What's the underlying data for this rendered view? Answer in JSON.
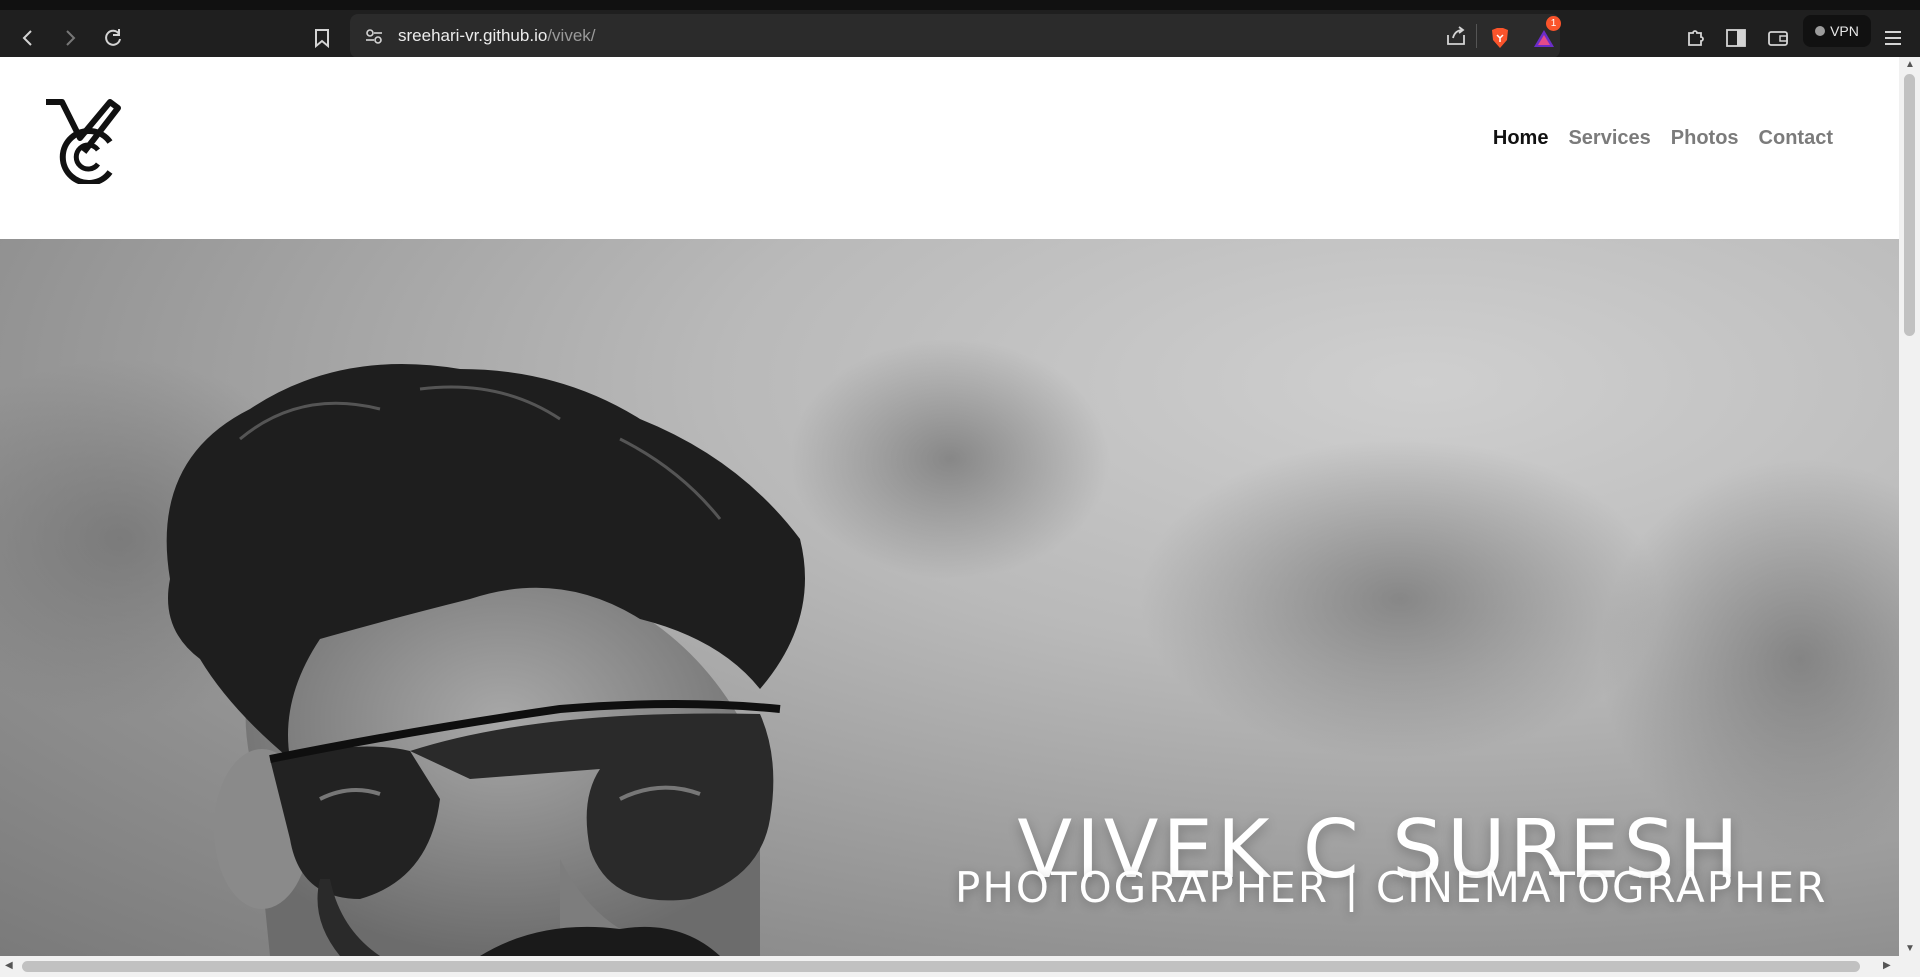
{
  "browser": {
    "url_host": "sreehari-vr.github.io",
    "url_path": "/vivek/",
    "vpn_label": "VPN",
    "notification_count": "1",
    "icons": {
      "back": "back-arrow-icon",
      "forward": "forward-arrow-icon",
      "reload": "reload-icon",
      "bookmark": "bookmark-icon",
      "site_settings": "site-settings-icon",
      "share": "share-icon",
      "brave_shields": "brave-lion-icon",
      "rewards": "rewards-triangle-icon",
      "extensions": "puzzle-icon",
      "sidebar": "sidebar-icon",
      "wallet": "wallet-icon",
      "menu": "hamburger-menu-icon"
    }
  },
  "site": {
    "logo_letters": "VC",
    "nav": [
      {
        "label": "Home",
        "active": true
      },
      {
        "label": "Services",
        "active": false
      },
      {
        "label": "Photos",
        "active": false
      },
      {
        "label": "Contact",
        "active": false
      }
    ]
  },
  "hero": {
    "name": "VIVEK C SURESH",
    "subtitle": "PHOTOGRAPHER | CINEMATOGRAPHER"
  },
  "colors": {
    "chrome_bg": "#1f1f1f",
    "nav_active": "#111111",
    "nav_inactive": "#7b7b7b",
    "brave_orange": "#fb542b"
  }
}
